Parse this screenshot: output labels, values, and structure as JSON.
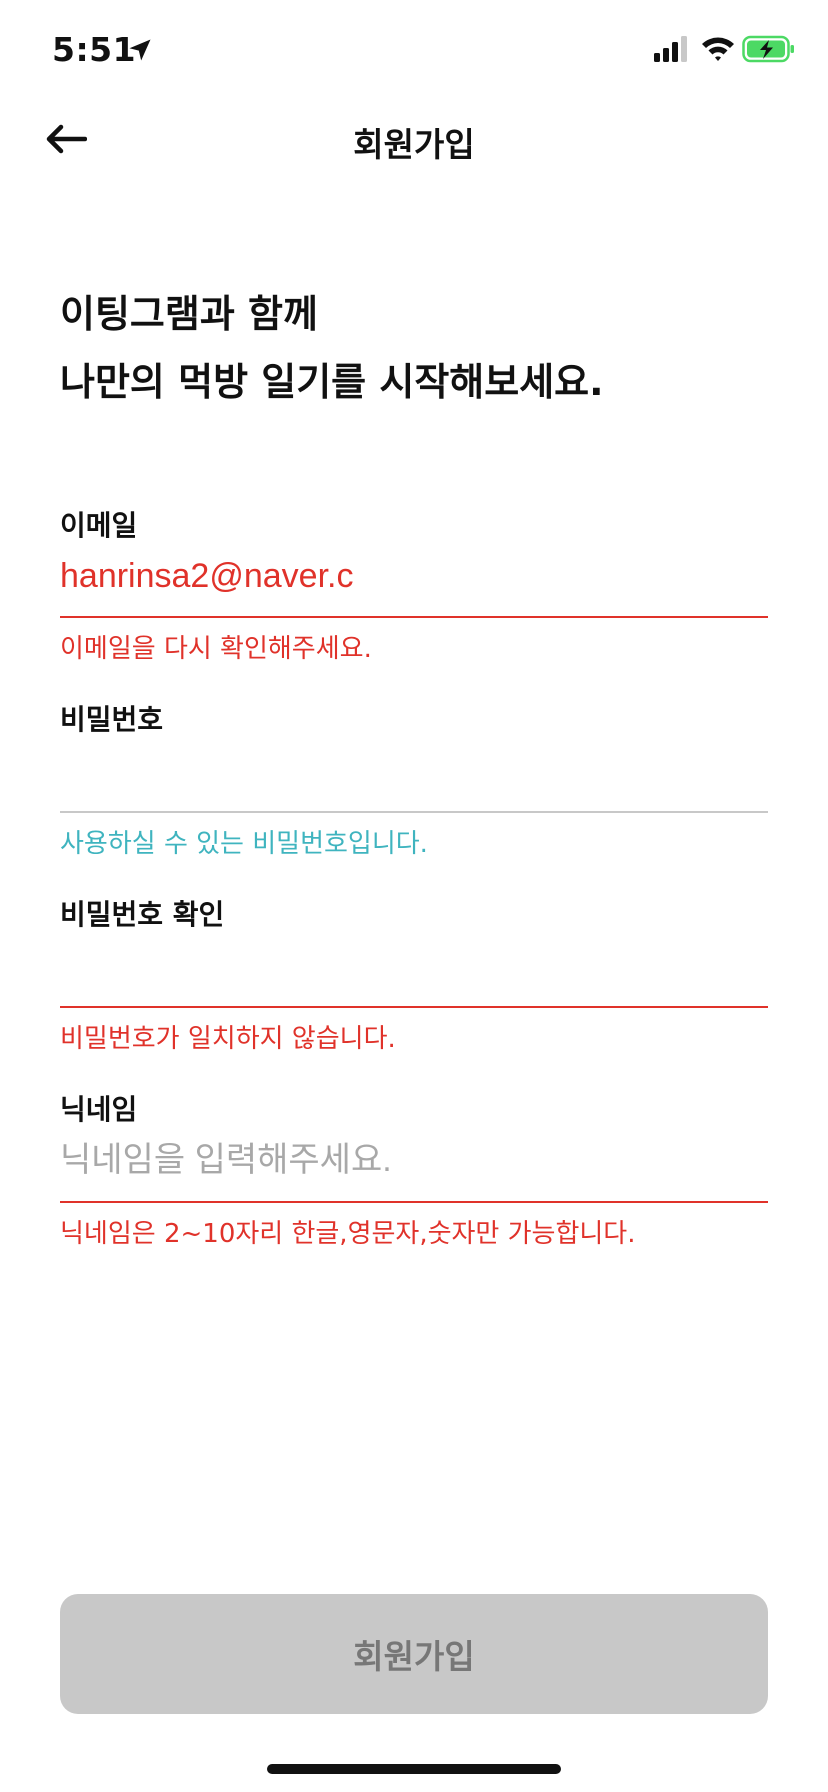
{
  "status": {
    "time": "5:51"
  },
  "nav": {
    "title": "회원가입"
  },
  "headline": {
    "line1": "이팅그램과 함께",
    "line2": "나만의 먹방 일기를 시작해보세요."
  },
  "form": {
    "email": {
      "label": "이메일",
      "value": "hanrinsa2@naver.c",
      "helper": "이메일을 다시 확인해주세요."
    },
    "password": {
      "label": "비밀번호",
      "value": "",
      "helper": "사용하실 수 있는 비밀번호입니다."
    },
    "password_confirm": {
      "label": "비밀번호 확인",
      "value": "",
      "helper": "비밀번호가 일치하지 않습니다."
    },
    "nickname": {
      "label": "닉네임",
      "placeholder": "닉네임을 입력해주세요.",
      "helper": "닉네임은 2~10자리 한글,영문자,숫자만 가능합니다."
    }
  },
  "submit": {
    "label": "회원가입"
  },
  "colors": {
    "error": "#e0322a",
    "success": "#3fb4bf",
    "button_disabled": "#c8c8c8",
    "battery_charging": "#4cd964"
  },
  "icons": [
    "location-arrow-icon",
    "cellular-signal-icon",
    "wifi-icon",
    "battery-charging-icon",
    "back-arrow-icon"
  ]
}
